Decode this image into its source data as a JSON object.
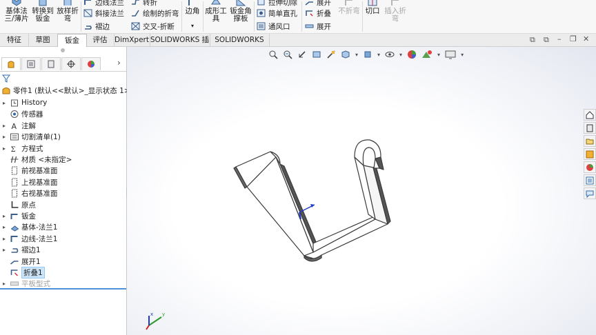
{
  "ribbon": {
    "base_flange": "基体法\n兰/薄片",
    "base_flange_l1": "基体法",
    "base_flange_l2": "三/薄片",
    "convert": "转换到",
    "convert2": "钣金",
    "lofted": "放样折",
    "lofted2": "弯",
    "edge_flange": "边线法兰",
    "miter_flange": "斜接法兰",
    "hem": "褶边",
    "jog": "转折",
    "sketched_bend": "绘制的折弯",
    "cross_break": "交叉-折断",
    "corners": "边角",
    "forming_tool": "成形工",
    "forming_tool2": "具",
    "gusset": "钣金角",
    "gusset2": "撑板",
    "extruded_cut": "拉伸切除",
    "simple_hole": "简单直孔",
    "vent": "通风口",
    "unfold": "展开",
    "fold": "折叠",
    "flatten": "展开",
    "no_bends": "不折弯",
    "rip": "切口",
    "insert_bends": "插入折",
    "insert_bends2": "弯"
  },
  "tabs": [
    {
      "label": "特征"
    },
    {
      "label": "草图"
    },
    {
      "label": "钣金"
    },
    {
      "label": "评估"
    },
    {
      "label": "DimXpert"
    },
    {
      "label": "SOLIDWORKS 插件"
    },
    {
      "label": "SOLIDWORKS MBD"
    }
  ],
  "tree": {
    "root": "零件1 (默认<<默认>_显示状态 1>)",
    "items": [
      {
        "label": "History",
        "arrow": "▸",
        "icon": "history-icon"
      },
      {
        "label": "传感器",
        "arrow": "",
        "icon": "sensor-icon"
      },
      {
        "label": "注解",
        "arrow": "▸",
        "icon": "annotation-icon"
      },
      {
        "label": "切割清单(1)",
        "arrow": "▸",
        "icon": "cutlist-icon"
      },
      {
        "label": "方程式",
        "arrow": "▸",
        "icon": "equation-icon"
      },
      {
        "label": "材质 <未指定>",
        "arrow": "",
        "icon": "material-icon"
      },
      {
        "label": "前视基准面",
        "arrow": "",
        "icon": "plane-icon"
      },
      {
        "label": "上视基准面",
        "arrow": "",
        "icon": "plane-icon"
      },
      {
        "label": "右视基准面",
        "arrow": "",
        "icon": "plane-icon"
      },
      {
        "label": "原点",
        "arrow": "",
        "icon": "origin-icon"
      },
      {
        "label": "钣金",
        "arrow": "▸",
        "icon": "sheetmetal-icon"
      },
      {
        "label": "基体-法兰1",
        "arrow": "▸",
        "icon": "base-flange-icon"
      },
      {
        "label": "边线-法兰1",
        "arrow": "▸",
        "icon": "edge-flange-icon"
      },
      {
        "label": "褶边1",
        "arrow": "▸",
        "icon": "hem-icon"
      },
      {
        "label": "展开1",
        "arrow": "",
        "icon": "unfold-icon"
      },
      {
        "label": "折叠1",
        "arrow": "",
        "icon": "fold-icon"
      },
      {
        "label": "平板型式",
        "arrow": "▸",
        "icon": "flat-pattern-icon"
      }
    ]
  },
  "triad": {
    "x": "x",
    "y": "y"
  },
  "colors": {
    "accent": "#4a90d9",
    "selection": "#cce4f7",
    "ribbon_bg": "#f7f7f7",
    "part_edge": "#4a4a4a"
  }
}
